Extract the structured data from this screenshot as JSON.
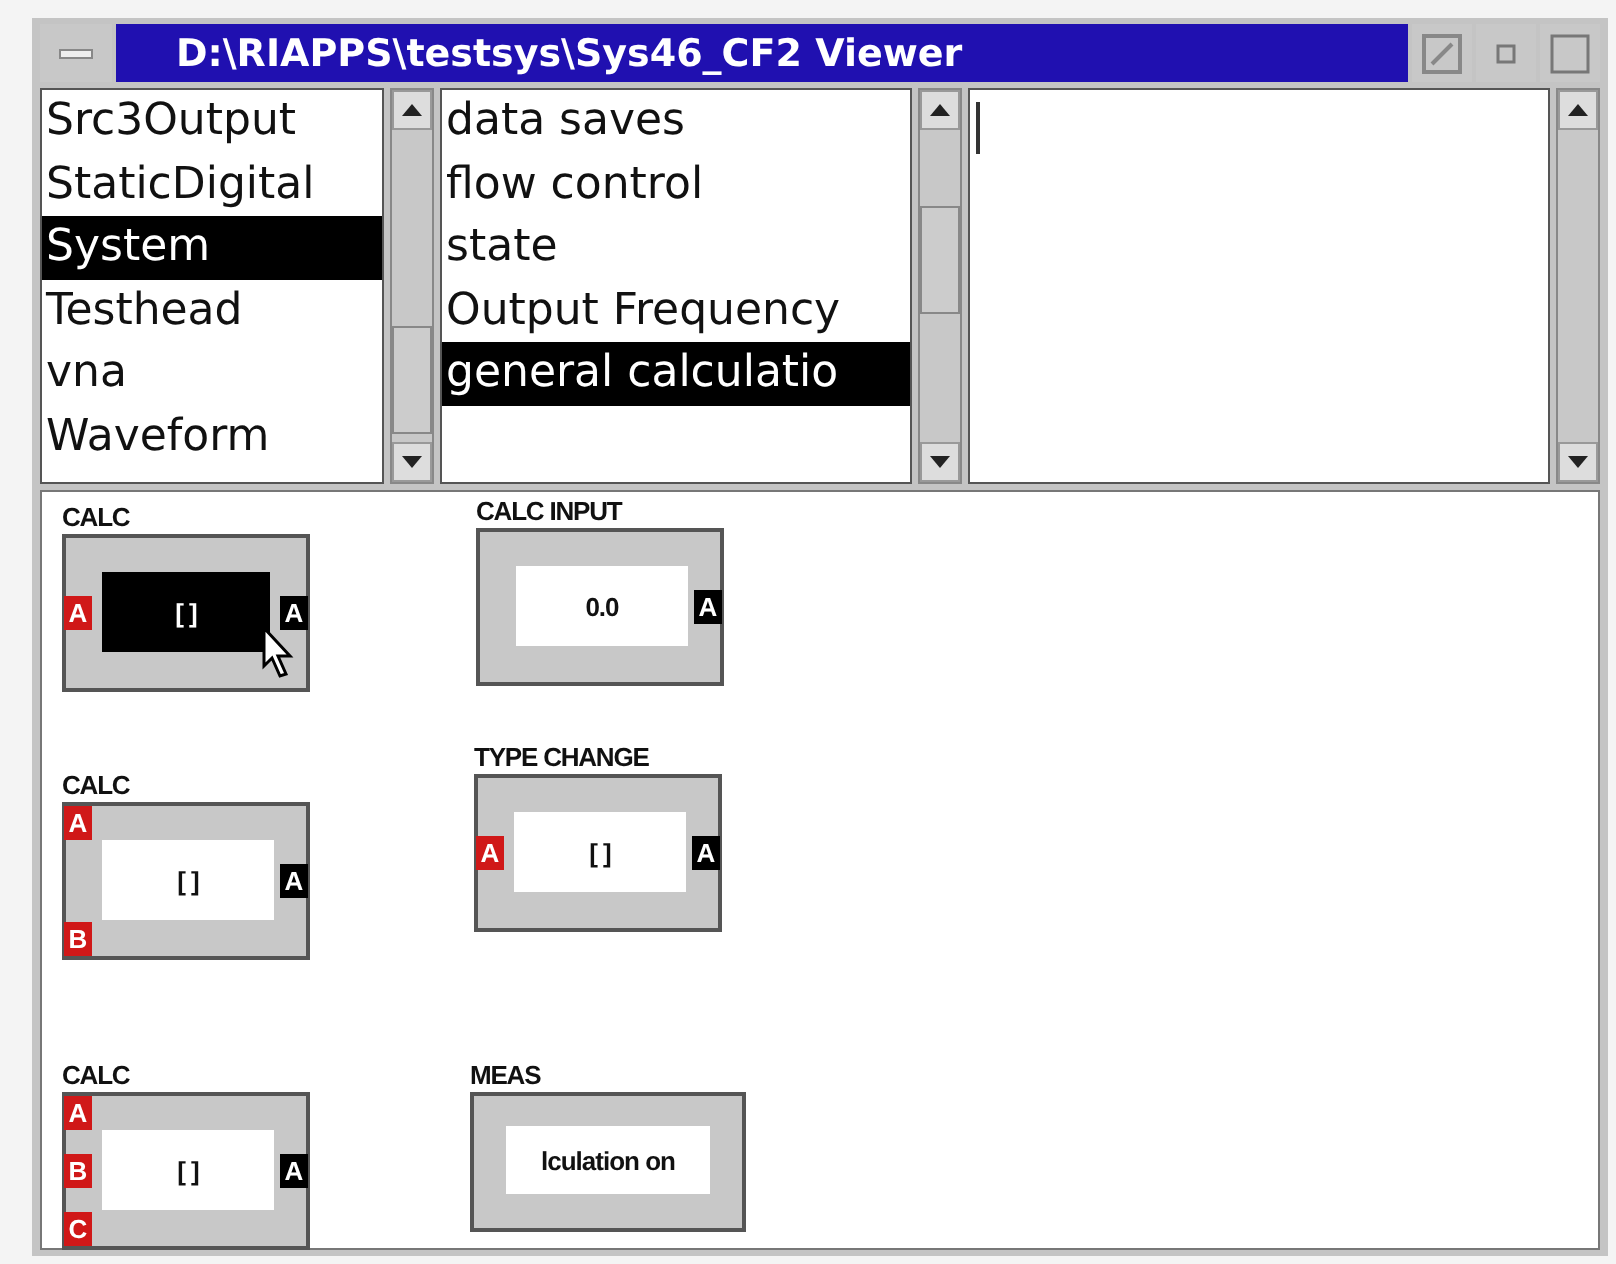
{
  "window": {
    "title": "D:\\RIAPPS\\testsys\\Sys46_CF2 Viewer"
  },
  "lists": [
    {
      "items": [
        {
          "label": "Src3Output",
          "selected": false
        },
        {
          "label": "StaticDigital",
          "selected": false
        },
        {
          "label": "System",
          "selected": true
        },
        {
          "label": "Testhead",
          "selected": false
        },
        {
          "label": "vna",
          "selected": false
        },
        {
          "label": "Waveform",
          "selected": false
        }
      ]
    },
    {
      "items": [
        {
          "label": "data saves",
          "selected": false
        },
        {
          "label": "flow control",
          "selected": false
        },
        {
          "label": "state",
          "selected": false
        },
        {
          "label": "Output Frequency",
          "selected": false
        },
        {
          "label": "general calculatio",
          "selected": true
        }
      ]
    }
  ],
  "nodes": [
    {
      "kind": "block",
      "label": "CALC",
      "value": "[ ]",
      "selected": true,
      "inputs": [
        "A"
      ],
      "outputs": [
        "A"
      ]
    },
    {
      "kind": "block",
      "label": "CALC",
      "value": "[ ]",
      "selected": false,
      "inputs": [
        "A",
        "B"
      ],
      "outputs": [
        "A"
      ]
    },
    {
      "kind": "block",
      "label": "CALC",
      "value": "[ ]",
      "selected": false,
      "inputs": [
        "A",
        "B",
        "C"
      ],
      "outputs": [
        "A"
      ]
    },
    {
      "kind": "block",
      "label": "CALC INPUT",
      "value": "0.0",
      "selected": false,
      "outputs": [
        "A"
      ]
    },
    {
      "kind": "block",
      "label": "TYPE CHANGE",
      "value": "[ ]",
      "selected": false,
      "inputs": [
        "A"
      ],
      "outputs": [
        "A"
      ]
    },
    {
      "kind": "display",
      "label": "MEAS",
      "value": "lculation on",
      "selected": false
    }
  ]
}
